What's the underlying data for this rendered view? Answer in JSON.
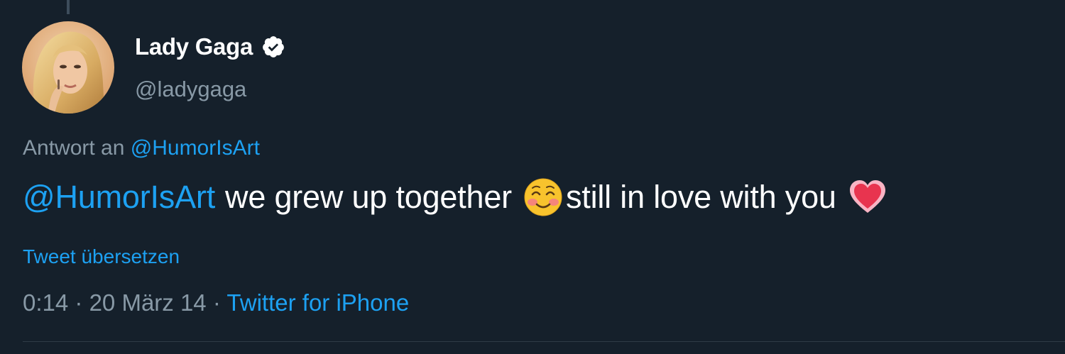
{
  "tweet": {
    "author": {
      "display_name": "Lady Gaga",
      "handle": "@ladygaga",
      "verified": true,
      "avatar_icon": "avatar-photo",
      "verified_icon": "verified-badge-icon"
    },
    "reply_context": {
      "prefix": "Antwort an",
      "mention": "@HumorIsArt"
    },
    "body": {
      "mention": "@HumorIsArt",
      "text_part1": "we grew up together",
      "emoji1": "smiling-face-with-blush-emoji",
      "text_part2": "still in love with you",
      "emoji2": "heart-emoji"
    },
    "translate_label": "Tweet übersetzen",
    "meta": {
      "time": "0:14",
      "separator": "·",
      "date": "20 März 14",
      "source": "Twitter for iPhone"
    }
  },
  "colors": {
    "background": "#15202b",
    "link": "#1da1f2",
    "secondary_text": "#8899a6",
    "primary_text": "#ffffff"
  }
}
